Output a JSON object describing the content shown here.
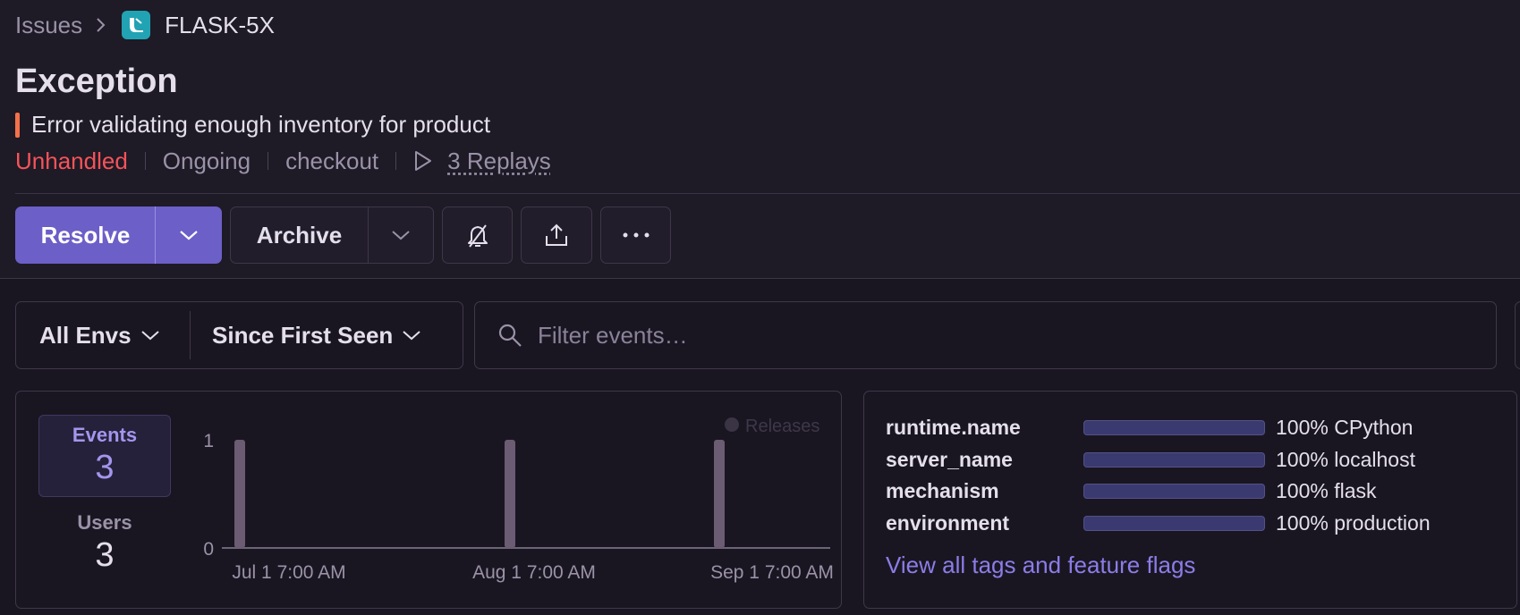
{
  "breadcrumb": {
    "root": "Issues",
    "project": "FLASK-5X"
  },
  "issue": {
    "title": "Exception",
    "subtitle": "Error validating enough inventory for product",
    "meta": {
      "handled": "Unhandled",
      "status": "Ongoing",
      "transaction": "checkout",
      "replays": "3 Replays"
    }
  },
  "actions": {
    "resolve": "Resolve",
    "archive": "Archive"
  },
  "filters": {
    "env": "All Envs",
    "range": "Since First Seen",
    "search_placeholder": "Filter events…"
  },
  "stats": {
    "events_label": "Events",
    "events_value": "3",
    "users_label": "Users",
    "users_value": "3"
  },
  "chart_data": {
    "type": "bar",
    "x": [
      "Jul 1 7:00 AM",
      "Aug 1 7:00 AM",
      "Sep 1 7:00 AM"
    ],
    "values": [
      1,
      1,
      1
    ],
    "yticks": [
      "1",
      "0"
    ],
    "ylim": [
      0,
      1
    ],
    "legend": "Releases",
    "legend_position": "top-right",
    "grid": false,
    "bar_color": "#6b5b73"
  },
  "tags": [
    {
      "key": "runtime.name",
      "percent": 1.0,
      "value": "100% CPython"
    },
    {
      "key": "server_name",
      "percent": 1.0,
      "value": "100% localhost"
    },
    {
      "key": "mechanism",
      "percent": 1.0,
      "value": "100% flask"
    },
    {
      "key": "environment",
      "percent": 1.0,
      "value": "100% production"
    }
  ],
  "view_all": "View all tags and feature flags",
  "colors": {
    "accent": "#6c5fc7",
    "error": "#f55459",
    "level": "#f4714b",
    "link": "#8b7de8"
  }
}
